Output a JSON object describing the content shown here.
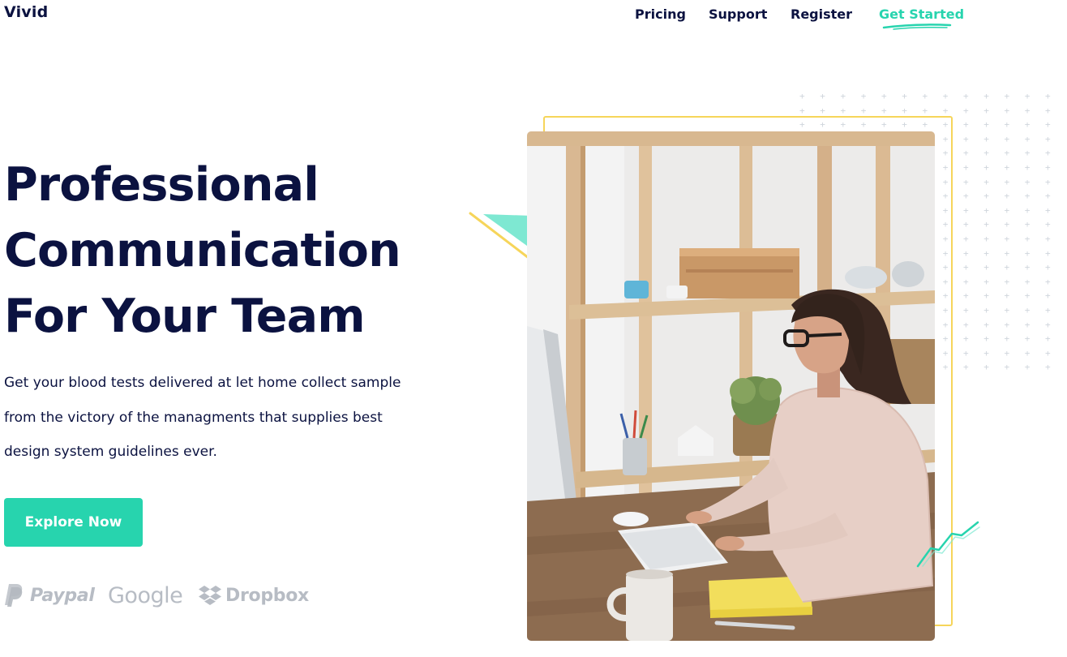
{
  "brand": {
    "name": "Vivid"
  },
  "nav": {
    "items": [
      {
        "label": "Pricing"
      },
      {
        "label": "Support"
      },
      {
        "label": "Register"
      },
      {
        "label": "Get Started"
      }
    ]
  },
  "hero": {
    "title_lines": [
      "Professional",
      "Communication",
      "For Your Team"
    ],
    "description": "Get your blood tests delivered at let home collect sample from the victory of the managments that supplies best design system guidelines ever.",
    "cta_label": "Explore Now",
    "image_alt": "Woman working at a computer in front of wooden shelves"
  },
  "partners": [
    {
      "name": "Paypal",
      "icon": "paypal-icon"
    },
    {
      "name": "Google",
      "icon": "google-wordmark"
    },
    {
      "name": "Dropbox",
      "icon": "dropbox-icon"
    }
  ],
  "colors": {
    "primary": "#27d4ae",
    "heading": "#0b1240",
    "accent_yellow": "#f6d55a",
    "partner_gray": "#b7bcc4"
  }
}
